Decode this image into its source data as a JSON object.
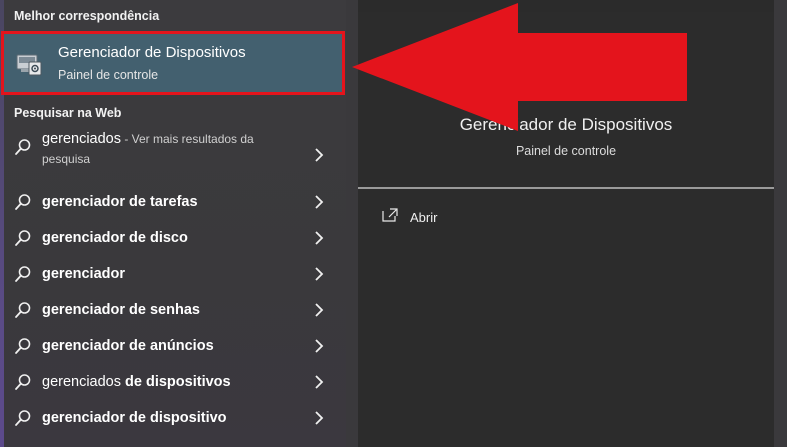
{
  "best_match": {
    "section_title": "Melhor correspondência",
    "title": "Gerenciador de Dispositivos",
    "subtitle": "Painel de controle",
    "icon": "device-manager-icon"
  },
  "web": {
    "section_title": "Pesquisar na Web",
    "results": [
      {
        "normal": "gerenciados",
        "bold": "",
        "more": " - Ver mais resultados da pesquisa"
      },
      {
        "normal": "",
        "bold": "gerenciador de tarefas"
      },
      {
        "normal": "",
        "bold": "gerenciador de disco"
      },
      {
        "normal": "",
        "bold": "gerenciador"
      },
      {
        "normal": "",
        "bold": "gerenciador de senhas"
      },
      {
        "normal": "",
        "bold": "gerenciador de anúncios"
      },
      {
        "normal": "gerenciados ",
        "bold": "de dispositivos"
      },
      {
        "normal": "",
        "bold": "gerenciador de dispositivo"
      }
    ]
  },
  "preview": {
    "title": "Gerenciador de Dispositivos",
    "subtitle": "Painel de controle",
    "action_open": "Abrir"
  },
  "colors": {
    "highlight_border": "#e4141c",
    "arrow": "#e4141c",
    "selected_bg": "#43606f"
  }
}
